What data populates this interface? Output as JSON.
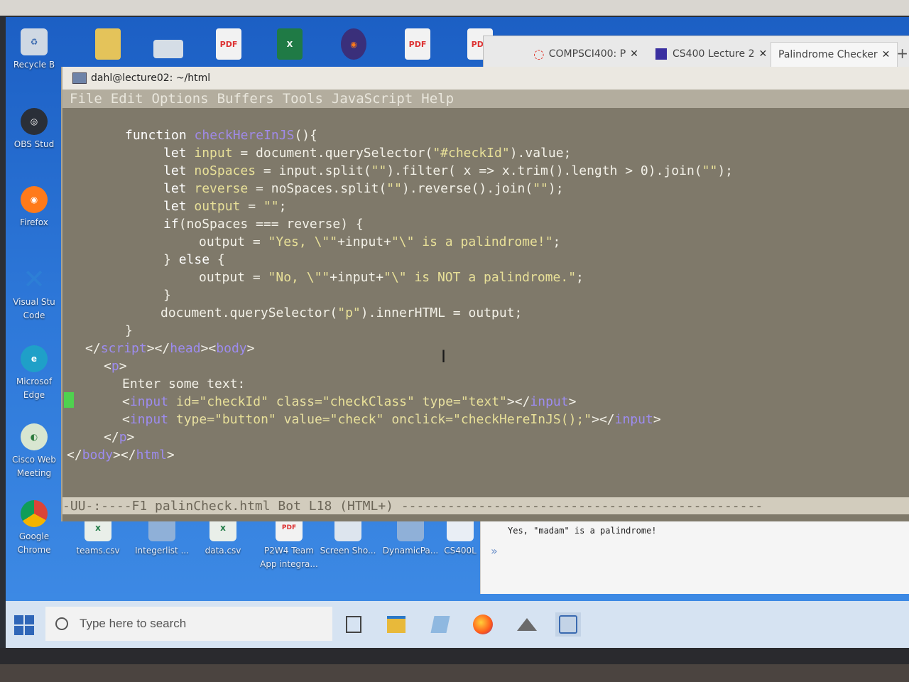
{
  "desktop": {
    "left_icons": [
      {
        "label": "Recycle B",
        "icon": "recycle-bin-icon"
      },
      {
        "label": "OBS Stud",
        "icon": "obs-icon"
      },
      {
        "label": "Firefox",
        "icon": "firefox-icon"
      },
      {
        "label": "Visual Stu Code",
        "icon": "vscode-icon"
      },
      {
        "label": "Microsof Edge",
        "icon": "edge-icon"
      },
      {
        "label": "Cisco Web Meeting",
        "icon": "webex-icon"
      },
      {
        "label": "Google Chrome",
        "icon": "chrome-icon"
      }
    ],
    "bottom_icons": [
      {
        "label": "teams.csv"
      },
      {
        "label": "Integerlist ..."
      },
      {
        "label": "data.csv"
      },
      {
        "label": "P2W4 Team App integra..."
      },
      {
        "label": "Screen Sho..."
      },
      {
        "label": "DynamicPa..."
      },
      {
        "label": "CS400L"
      }
    ],
    "top_icon_labels": [
      "PDF",
      "X",
      "PDF",
      "PDF"
    ]
  },
  "browser": {
    "tabs": [
      {
        "label": "COMPSCI400: P"
      },
      {
        "label": "CS400 Lecture 2"
      },
      {
        "label": "Palindrome Checker"
      }
    ],
    "close_glyph": "✕",
    "new_tab": "+",
    "output_text": "Yes, \"madam\" is a palindrome!",
    "console_prompt": "»"
  },
  "emacs": {
    "title": "dahl@lecture02: ~/html",
    "menu": [
      "File",
      "Edit",
      "Options",
      "Buffers",
      "Tools",
      "JavaScript",
      "Help"
    ],
    "code": {
      "l1_kw": "function ",
      "l1_fn": "checkHereInJS",
      "l1_rest": "(){",
      "l2_kw": "let ",
      "l2_var": "input",
      "l2_a": " = document.querySelector(",
      "l2_s": "\"#checkId\"",
      "l2_b": ").value;",
      "l3_kw": "let ",
      "l3_var": "noSpaces",
      "l3_a": " = input.split(",
      "l3_s1": "\"\"",
      "l3_b": ").filter( x => x.trim().length > 0).join(",
      "l3_s2": "\"\"",
      "l3_c": ");",
      "l4_kw": "let ",
      "l4_var": "reverse",
      "l4_a": " = noSpaces.split(",
      "l4_s1": "\"\"",
      "l4_b": ").reverse().join(",
      "l4_s2": "\"\"",
      "l4_c": ");",
      "l5_kw": "let ",
      "l5_var": "output",
      "l5_a": " = ",
      "l5_s": "\"\"",
      "l5_b": ";",
      "l6_kw": "if",
      "l6_a": "(noSpaces === reverse) {",
      "l7_a": "output = ",
      "l7_s1": "\"Yes, \\\"\"",
      "l7_b": "+input+",
      "l7_s2": "\"\\\" is a palindrome!\"",
      "l7_c": ";",
      "l8_a": "} ",
      "l8_kw": "else",
      "l8_b": " {",
      "l9_a": "output = ",
      "l9_s1": "\"No, \\\"\"",
      "l9_b": "+input+",
      "l9_s2": "\"\\\" is NOT a palindrome.\"",
      "l9_c": ";",
      "l10": "}",
      "l11_a": "document.querySelector(",
      "l11_s": "\"p\"",
      "l11_b": ").innerHTML = output;",
      "l12": "}",
      "l13_p1": "</",
      "l13_t1": "script",
      "l13_p2": "></",
      "l13_t2": "head",
      "l13_p3": "><",
      "l13_t3": "body",
      "l13_p4": ">",
      "l14_p1": "<",
      "l14_t1": "p",
      "l14_p2": ">",
      "l15": "Enter some text:",
      "l16_p1": "<",
      "l16_t1": "input",
      "l16_a1": " id=",
      "l16_s1": "\"checkId\"",
      "l16_a2": " class=",
      "l16_s2": "\"checkClass\"",
      "l16_a3": " type=",
      "l16_s3": "\"text\"",
      "l16_p2": "></",
      "l16_t2": "input",
      "l16_p3": ">",
      "l17_p1": "<",
      "l17_t1": "input",
      "l17_a1": " type=",
      "l17_s1": "\"button\"",
      "l17_a2": " value=",
      "l17_s2": "\"check\"",
      "l17_a3": " onclick=",
      "l17_s3": "\"checkHereInJS();\"",
      "l17_p2": "></",
      "l17_t2": "input",
      "l17_p3": ">",
      "l18_p1": "</",
      "l18_t1": "p",
      "l18_p2": ">",
      "l19_p1": "</",
      "l19_t1": "body",
      "l19_p2": "></",
      "l19_t2": "html",
      "l19_p3": ">"
    },
    "modeline": "-UU-:----F1  palinCheck.html   Bot L18    (HTML+) -----------------------------------------------"
  },
  "taskbar": {
    "search_placeholder": "Type here to search"
  }
}
